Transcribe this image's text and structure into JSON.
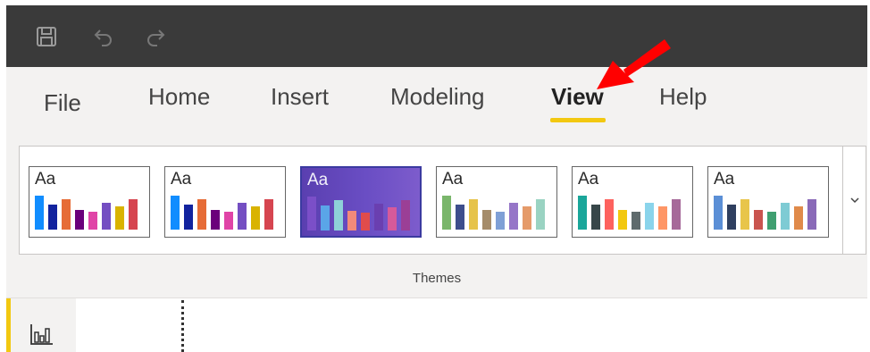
{
  "titlebar": {
    "icons": [
      "save-icon",
      "undo-icon",
      "redo-icon"
    ],
    "background": "#3a3a3a"
  },
  "tabs": [
    {
      "label": "File"
    },
    {
      "label": "Home"
    },
    {
      "label": "Insert"
    },
    {
      "label": "Modeling"
    },
    {
      "label": "View",
      "active": true
    },
    {
      "label": "Help"
    }
  ],
  "accent_color": "#f2c811",
  "ribbon": {
    "group_label": "Themes",
    "themes": [
      {
        "sample": "Aa",
        "colors": [
          "#118dff",
          "#12239e",
          "#e66c37",
          "#6b007b",
          "#e044a7",
          "#744ec2",
          "#d9b300",
          "#d64550"
        ]
      },
      {
        "sample": "Aa",
        "colors": [
          "#118dff",
          "#12239e",
          "#e66c37",
          "#6b007b",
          "#e044a7",
          "#744ec2",
          "#d9b300",
          "#d64550"
        ]
      },
      {
        "sample": "Aa",
        "selected": true,
        "colors": [
          "#7b4fc8",
          "#5aa5e8",
          "#8ed1d8",
          "#f28a7a",
          "#e04c4c",
          "#6a3fb0",
          "#d65a9a",
          "#9b3f96"
        ]
      },
      {
        "sample": "Aa",
        "colors": [
          "#7ab66b",
          "#3d4e8c",
          "#e6c34a",
          "#a58c6a",
          "#7fa0d6",
          "#9676c8",
          "#e59b6a",
          "#9ad3c2"
        ]
      },
      {
        "sample": "Aa",
        "colors": [
          "#1aa69a",
          "#374649",
          "#fd625e",
          "#f2c80f",
          "#5f6b6d",
          "#8ad4eb",
          "#fe9666",
          "#a66999"
        ]
      },
      {
        "sample": "Aa",
        "colors": [
          "#5b8fd6",
          "#2f3f5f",
          "#e8c54a",
          "#c9544f",
          "#3f9f70",
          "#7ecbd4",
          "#e08a4a",
          "#8a6ab8"
        ]
      }
    ],
    "more_icon": "chevron-down-icon"
  },
  "left_rail": {
    "icon": "report-view-icon"
  }
}
